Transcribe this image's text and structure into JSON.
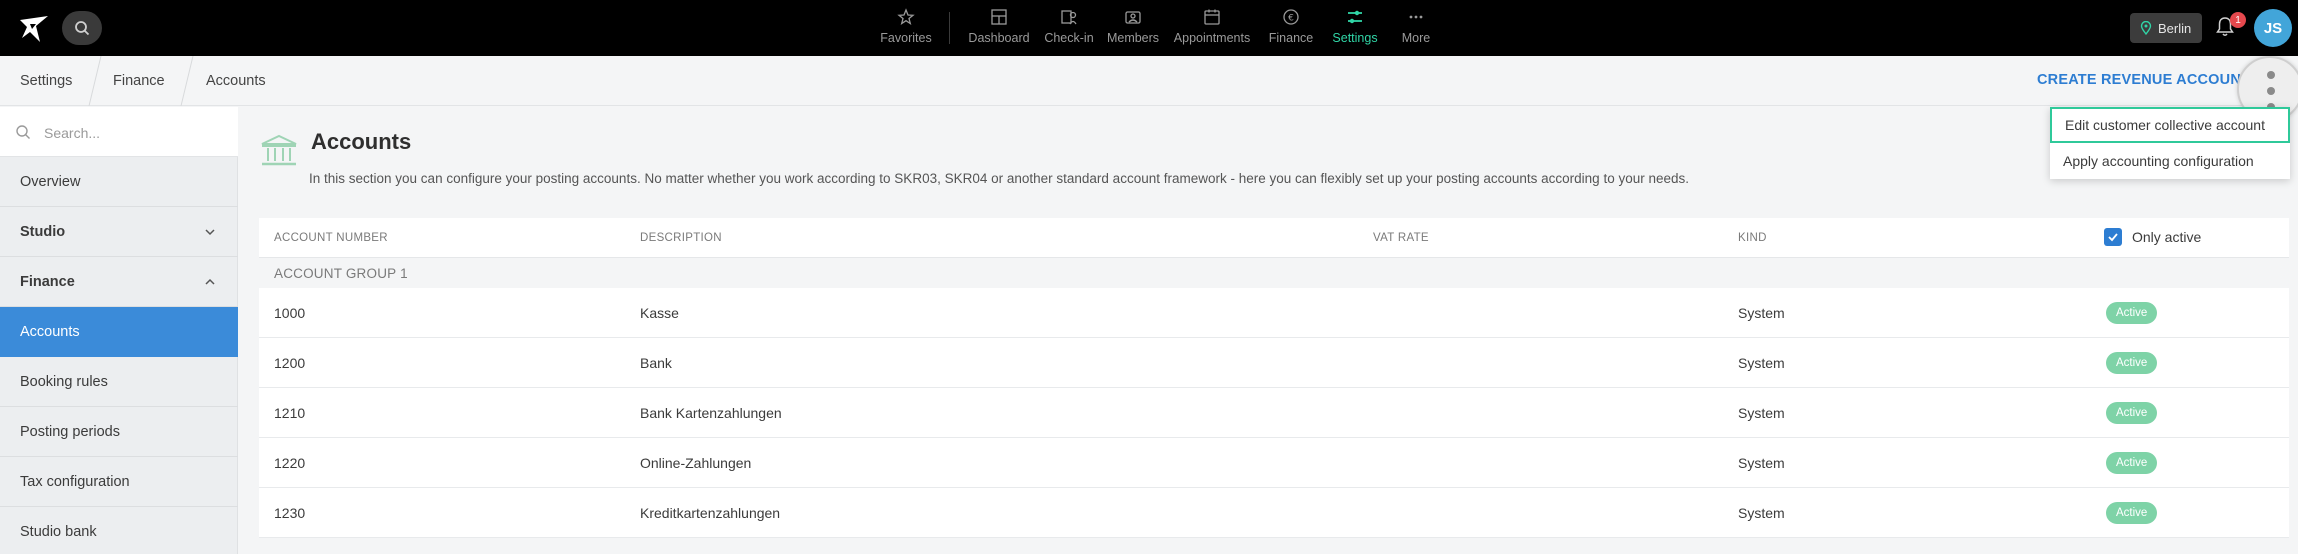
{
  "nav": {
    "items": [
      {
        "label": "Favorites",
        "icon": "star-icon"
      },
      {
        "label": "Dashboard",
        "icon": "dashboard-icon"
      },
      {
        "label": "Check-in",
        "icon": "checkin-icon"
      },
      {
        "label": "Members",
        "icon": "members-icon"
      },
      {
        "label": "Appointments",
        "icon": "calendar-icon"
      },
      {
        "label": "Finance",
        "icon": "euro-icon"
      },
      {
        "label": "Settings",
        "icon": "sliders-icon",
        "active": true
      },
      {
        "label": "More",
        "icon": "ellipsis-icon"
      }
    ],
    "location": "Berlin",
    "notifications": "1",
    "avatar_initials": "JS",
    "accent": "#30d5a6"
  },
  "breadcrumb": [
    "Settings",
    "Finance",
    "Accounts"
  ],
  "header_action": "CREATE REVENUE ACCOUNT",
  "menu": {
    "items": [
      "Edit customer collective account",
      "Apply accounting configuration"
    ]
  },
  "sidebar": {
    "search_placeholder": "Search...",
    "items": [
      {
        "label": "Overview"
      },
      {
        "label": "Studio",
        "expandable": true
      },
      {
        "label": "Finance",
        "expandable": true,
        "expanded": true
      },
      {
        "label": "Accounts",
        "active": true
      },
      {
        "label": "Booking rules"
      },
      {
        "label": "Posting periods"
      },
      {
        "label": "Tax configuration"
      },
      {
        "label": "Studio bank"
      }
    ]
  },
  "page": {
    "title": "Accounts",
    "description": "In this section you can configure your posting accounts. No matter whether you work according to SKR03, SKR04 or another standard account framework - here you can flexibly set up your posting accounts according to your needs."
  },
  "table": {
    "columns": [
      "ACCOUNT NUMBER",
      "DESCRIPTION",
      "VAT RATE",
      "KIND"
    ],
    "only_active_label": "Only active",
    "only_active_checked": true,
    "group": "ACCOUNT GROUP 1",
    "rows": [
      {
        "number": "1000",
        "description": "Kasse",
        "vat": "",
        "kind": "System",
        "status": "Active"
      },
      {
        "number": "1200",
        "description": "Bank",
        "vat": "",
        "kind": "System",
        "status": "Active"
      },
      {
        "number": "1210",
        "description": "Bank Kartenzahlungen",
        "vat": "",
        "kind": "System",
        "status": "Active"
      },
      {
        "number": "1220",
        "description": "Online-Zahlungen",
        "vat": "",
        "kind": "System",
        "status": "Active"
      },
      {
        "number": "1230",
        "description": "Kreditkartenzahlungen",
        "vat": "",
        "kind": "System",
        "status": "Active"
      }
    ]
  }
}
